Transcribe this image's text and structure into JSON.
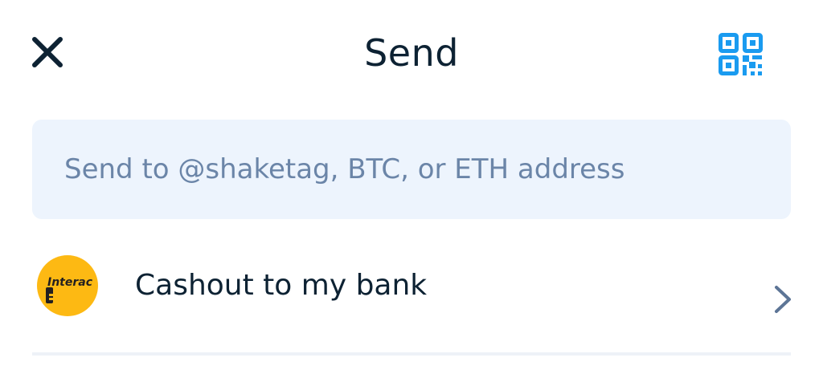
{
  "header": {
    "title": "Send",
    "close_icon": "close-icon",
    "qr_icon": "qr-code-scan-icon"
  },
  "search": {
    "placeholder": "Send to @shaketag, BTC, or ETH address",
    "value": ""
  },
  "cashout": {
    "logo_text": "Interac",
    "label": "Cashout to my bank",
    "chevron_icon": "chevron-right-icon"
  },
  "colors": {
    "text": "#0d2233",
    "placeholder": "#6b85a8",
    "accent": "#1a9bf0",
    "field_bg": "#edf4fd",
    "interac_yellow": "#fdb913",
    "chevron": "#5d7596"
  }
}
